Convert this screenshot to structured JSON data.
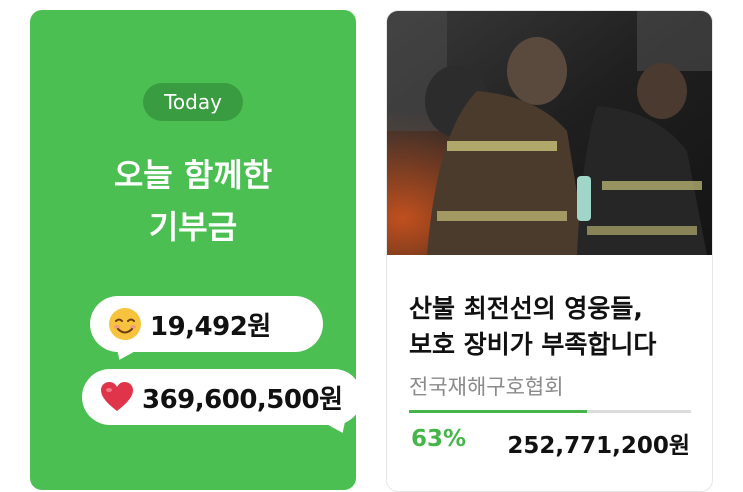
{
  "today_card": {
    "badge": "Today",
    "headline_line1": "오늘 함께한",
    "headline_line2": "기부금",
    "donors_amount": "19,492원",
    "donors_icon": "smiling-face-emoji-icon",
    "total_amount": "369,600,500원",
    "total_icon": "red-heart-emoji-icon",
    "colors": {
      "card_bg": "#4cbf52",
      "badge_bg": "#3a9c40"
    }
  },
  "campaign_card": {
    "image_alt": "firefighters resting",
    "title_line1": "산불 최전선의 영웅들,",
    "title_line2": "보호 장비가 부족합니다",
    "organization": "전국재해구호협회",
    "progress_percent_label": "63%",
    "progress_fraction": 0.63,
    "raised_amount": "252,771,200원",
    "colors": {
      "progress": "#45b54a",
      "track": "#dcdcdc"
    }
  }
}
